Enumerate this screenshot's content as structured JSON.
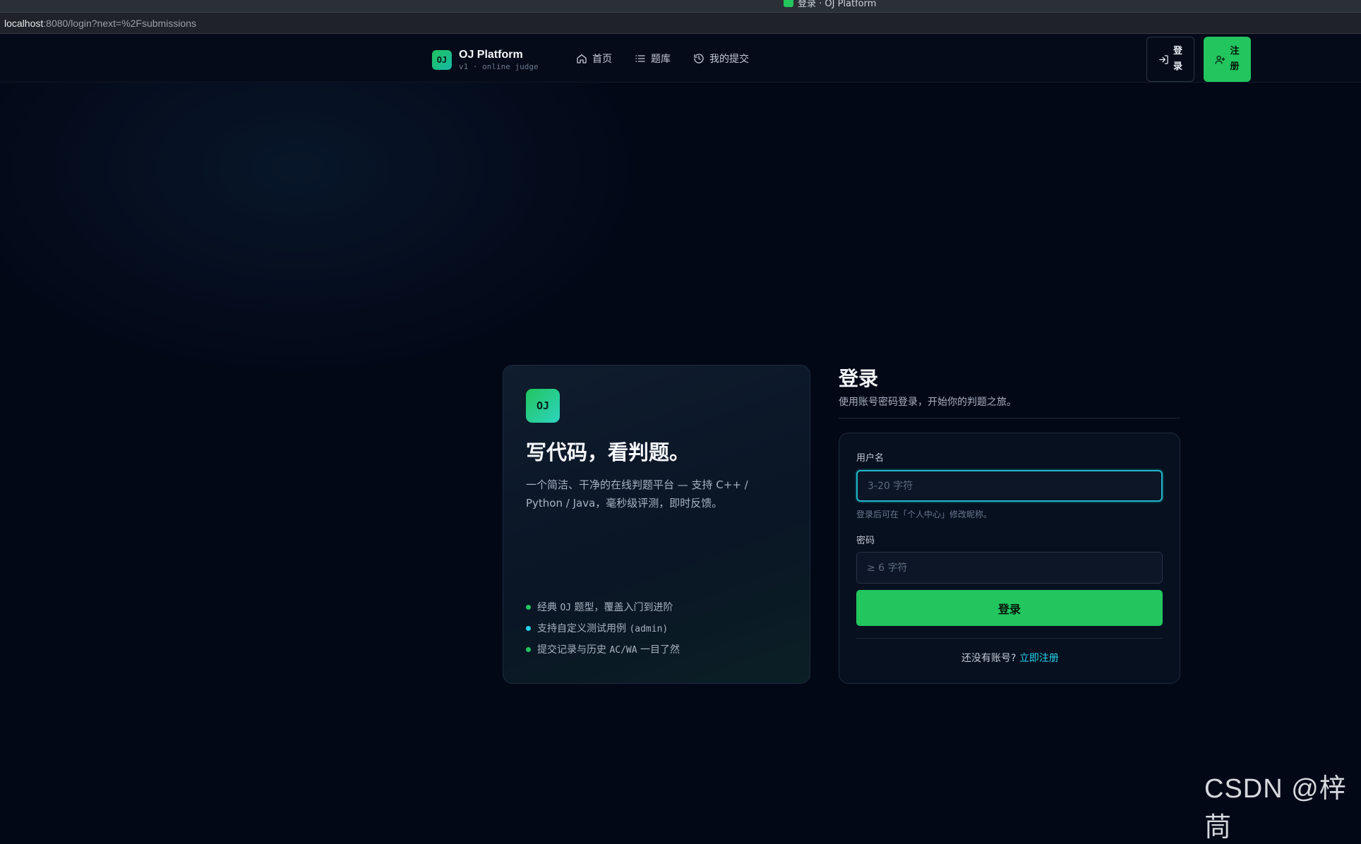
{
  "browser": {
    "tab_title": "登录 · OJ Platform",
    "url_host": "localhost",
    "url_rest": ":8080/login?next=%2Fsubmissions"
  },
  "navbar": {
    "brand_logo": "OJ",
    "brand_name": "OJ Platform",
    "brand_sub": "v1 · online judge",
    "links": [
      {
        "label": "首页",
        "icon": "home-icon"
      },
      {
        "label": "题库",
        "icon": "list-icon"
      },
      {
        "label": "我的提交",
        "icon": "history-icon"
      }
    ],
    "login_label": "登录",
    "login_label_top": "登",
    "login_label_bottom": "录",
    "register_label": "注册",
    "register_label_top": "注",
    "register_label_bottom": "册"
  },
  "hero": {
    "logo": "OJ",
    "title": "写代码，看判题。",
    "description": "一个简洁、干净的在线判题平台 — 支持 C++ / Python / Java，毫秒级评测，即时反馈。",
    "features": [
      {
        "prefix": "经典 ",
        "mono": "OJ",
        "suffix": " 题型，覆盖入门到进阶",
        "dot_color": "#22c55e"
      },
      {
        "prefix": "支持自定义测试用例 ",
        "mono": "(admin)",
        "suffix": "",
        "dot_color": "#22d3ee"
      },
      {
        "prefix": "提交记录与历史 ",
        "mono": "AC/WA",
        "suffix": " 一目了然",
        "dot_color": "#22c55e"
      }
    ]
  },
  "form": {
    "title": "登录",
    "subtitle": "使用账号密码登录，开始你的判题之旅。",
    "username_label": "用户名",
    "username_placeholder": "3-20 字符",
    "username_value": "",
    "username_hint": "登录后可在「个人中心」修改昵称。",
    "password_label": "密码",
    "password_placeholder": "≥ 6 字符",
    "password_value": "",
    "submit_label": "登录",
    "footer_text": "还没有账号?",
    "footer_link": "立即注册"
  },
  "colors": {
    "accent_green": "#22c55e",
    "accent_cyan": "#22d3ee",
    "background": "#030817"
  },
  "watermark": "CSDN @梓茼"
}
